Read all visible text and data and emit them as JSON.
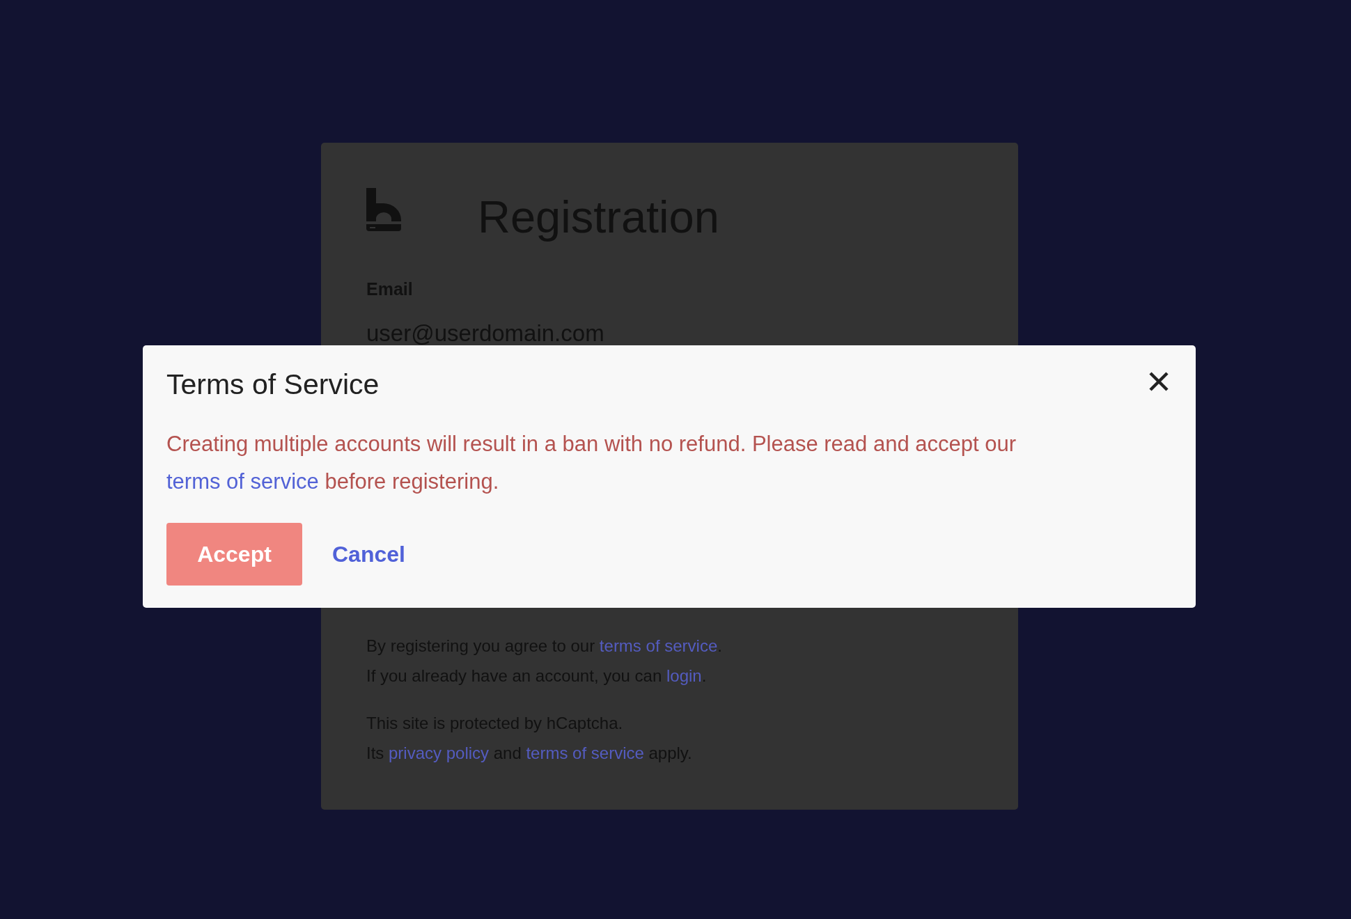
{
  "registration": {
    "title": "Registration",
    "email": {
      "label": "Email",
      "value": "user@userdomain.com"
    },
    "notices": [
      {
        "lines": [
          [
            {
              "kind": "text",
              "text": "By registering you agree to our "
            },
            {
              "kind": "link",
              "text": "terms of service"
            },
            {
              "kind": "text",
              "text": "."
            }
          ],
          [
            {
              "kind": "text",
              "text": "If you already have an account, you can "
            },
            {
              "kind": "link",
              "text": "login"
            },
            {
              "kind": "text",
              "text": "."
            }
          ]
        ]
      },
      {
        "lines": [
          [
            {
              "kind": "text",
              "text": "This site is protected by hCaptcha."
            }
          ],
          [
            {
              "kind": "text",
              "text": "Its "
            },
            {
              "kind": "link",
              "text": "privacy policy"
            },
            {
              "kind": "text",
              "text": " and "
            },
            {
              "kind": "link",
              "text": "terms of service"
            },
            {
              "kind": "text",
              "text": " apply."
            }
          ]
        ]
      }
    ]
  },
  "dialog": {
    "title": "Terms of Service",
    "message": [
      {
        "kind": "text",
        "text": "Creating multiple accounts will result in a ban with no refund. Please read and accept our "
      },
      {
        "kind": "link",
        "text": "terms of service"
      },
      {
        "kind": "text",
        "text": " before registering."
      }
    ],
    "buttons": [
      {
        "label": "Accept",
        "kind": "primary"
      },
      {
        "label": "Cancel",
        "kind": "link"
      }
    ]
  }
}
